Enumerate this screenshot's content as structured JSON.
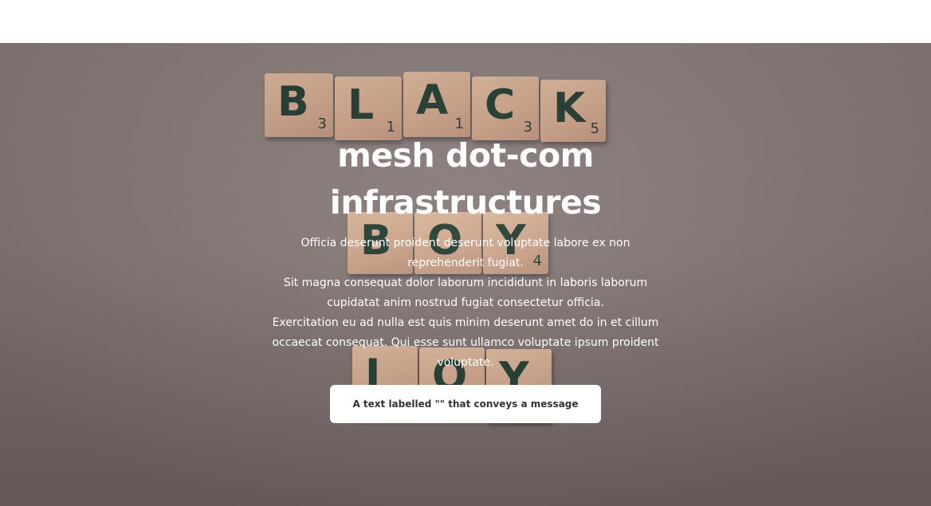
{
  "hero": {
    "title": "mesh dot-com infrastructures",
    "description_lines": [
      "Officia deserunt proident deserunt voluptate labore ex non reprehenderit fugiat.",
      "Sit magna consequat dolor laborum incididunt in laboris laborum cupidatat anim nostrud fugiat consectetur officia.",
      "Exercitation eu ad nulla est quis minim deserunt amet do in et cillum occaecat consequat. Qui esse sunt ullamco voluptate ipsum proident voluptate."
    ],
    "cta_label": "A text labelled \"\" that conveys a message",
    "tiles": {
      "row1": [
        {
          "letter": "B",
          "points": "3"
        },
        {
          "letter": "L",
          "points": "1"
        },
        {
          "letter": "A",
          "points": "1"
        },
        {
          "letter": "C",
          "points": "3"
        },
        {
          "letter": "K",
          "points": "5"
        }
      ],
      "row2": [
        {
          "letter": "B",
          "points": ""
        },
        {
          "letter": "O",
          "points": ""
        },
        {
          "letter": "Y",
          "points": "4"
        }
      ],
      "row3": [
        {
          "letter": "J",
          "points": ""
        },
        {
          "letter": "O",
          "points": ""
        },
        {
          "letter": "Y",
          "points": ""
        }
      ]
    },
    "colors": {
      "overlay": "#857876",
      "text": "#ffffff",
      "button_bg": "#ffffff",
      "button_text": "#333333",
      "tile_ink": "#203a2e"
    }
  }
}
